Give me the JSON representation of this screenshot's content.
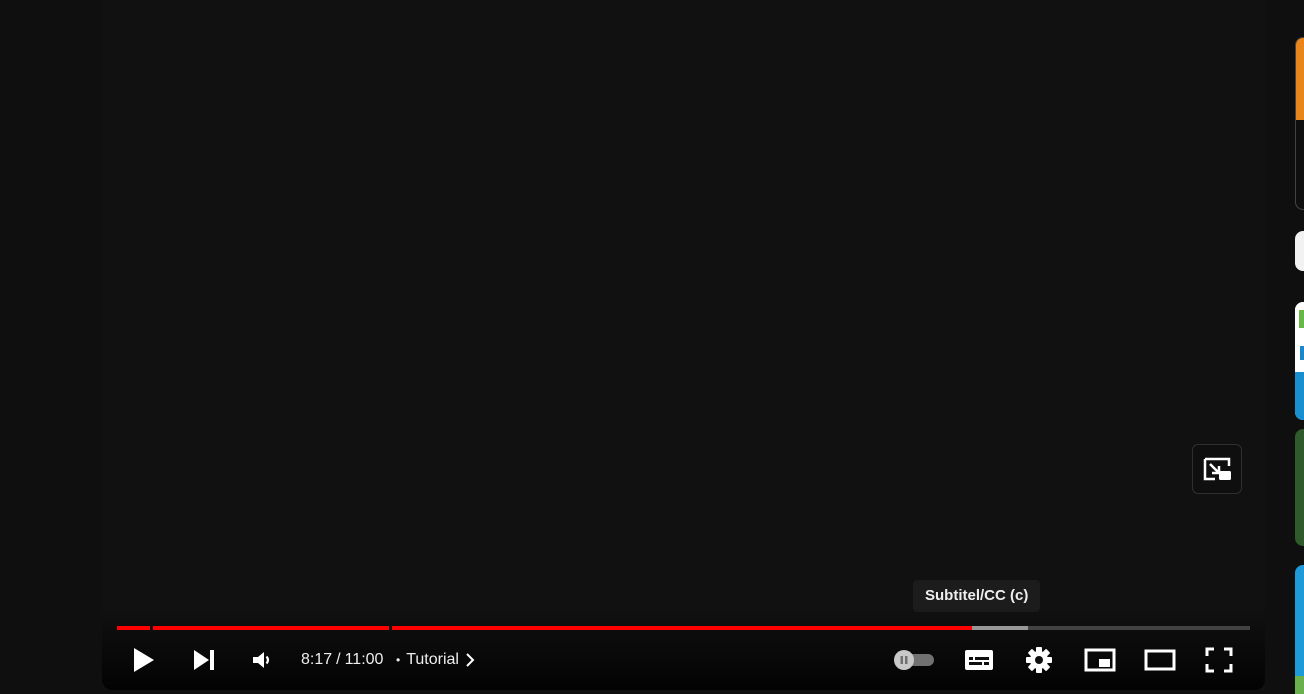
{
  "player": {
    "time_current": "8:17",
    "time_separator": "/",
    "time_total": "11:00",
    "chapter_label": "Tutorial",
    "tooltip": "Subtitel/CC (c)",
    "progress_played_fraction": 0.755,
    "progress_loaded_fraction": 0.804,
    "chapter_marker_fractions": [
      0.03,
      0.241
    ],
    "autoplay_on": false
  },
  "controls": {
    "play": "play-icon",
    "next": "skip-next-icon",
    "volume": "volume-icon",
    "autoplay": "autoplay-toggle",
    "subtitles": "subtitles-icon",
    "settings": "gear-icon",
    "miniplayer": "miniplayer-icon",
    "theater": "theater-mode-icon",
    "fullscreen": "fullscreen-icon",
    "expand_overlay": "expand-miniplayer-icon"
  },
  "colors": {
    "progress_played": "#ff0000",
    "background": "#0f0f0f",
    "thumb1_accent": "#e8861c",
    "thumb3": "#2e5a2c",
    "thumb4": "#1f9ad8"
  }
}
